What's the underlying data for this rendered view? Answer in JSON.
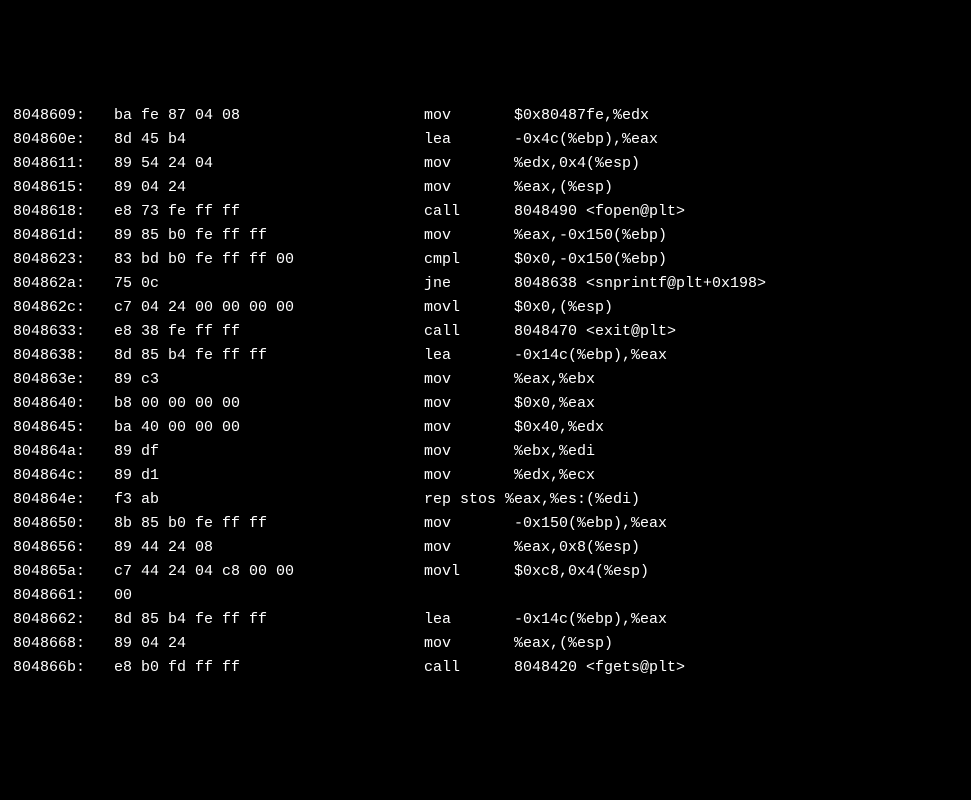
{
  "rows": [
    {
      "addr": " 8048609:",
      "bytes": "ba fe 87 04 08",
      "mnem": "mov",
      "ops": "$0x80487fe,%edx"
    },
    {
      "addr": " 804860e:",
      "bytes": "8d 45 b4",
      "mnem": "lea",
      "ops": "-0x4c(%ebp),%eax"
    },
    {
      "addr": " 8048611:",
      "bytes": "89 54 24 04",
      "mnem": "mov",
      "ops": "%edx,0x4(%esp)"
    },
    {
      "addr": " 8048615:",
      "bytes": "89 04 24",
      "mnem": "mov",
      "ops": "%eax,(%esp)"
    },
    {
      "addr": " 8048618:",
      "bytes": "e8 73 fe ff ff",
      "mnem": "call",
      "ops": "8048490 <fopen@plt>"
    },
    {
      "addr": " 804861d:",
      "bytes": "89 85 b0 fe ff ff",
      "mnem": "mov",
      "ops": "%eax,-0x150(%ebp)"
    },
    {
      "addr": " 8048623:",
      "bytes": "83 bd b0 fe ff ff 00",
      "mnem": "cmpl",
      "ops": "$0x0,-0x150(%ebp)"
    },
    {
      "addr": " 804862a:",
      "bytes": "75 0c",
      "mnem": "jne",
      "ops": "8048638 <snprintf@plt+0x198>"
    },
    {
      "addr": " 804862c:",
      "bytes": "c7 04 24 00 00 00 00",
      "mnem": "movl",
      "ops": "$0x0,(%esp)"
    },
    {
      "addr": " 8048633:",
      "bytes": "e8 38 fe ff ff",
      "mnem": "call",
      "ops": "8048470 <exit@plt>"
    },
    {
      "addr": " 8048638:",
      "bytes": "8d 85 b4 fe ff ff",
      "mnem": "lea",
      "ops": "-0x14c(%ebp),%eax"
    },
    {
      "addr": " 804863e:",
      "bytes": "89 c3",
      "mnem": "mov",
      "ops": "%eax,%ebx"
    },
    {
      "addr": " 8048640:",
      "bytes": "b8 00 00 00 00",
      "mnem": "mov",
      "ops": "$0x0,%eax"
    },
    {
      "addr": " 8048645:",
      "bytes": "ba 40 00 00 00",
      "mnem": "mov",
      "ops": "$0x40,%edx"
    },
    {
      "addr": " 804864a:",
      "bytes": "89 df",
      "mnem": "mov",
      "ops": "%ebx,%edi"
    },
    {
      "addr": " 804864c:",
      "bytes": "89 d1",
      "mnem": "mov",
      "ops": "%edx,%ecx"
    },
    {
      "addr": " 804864e:",
      "bytes": "f3 ab",
      "mnem": "rep stos %eax,%es:(%edi)",
      "ops": ""
    },
    {
      "addr": " 8048650:",
      "bytes": "8b 85 b0 fe ff ff",
      "mnem": "mov",
      "ops": "-0x150(%ebp),%eax"
    },
    {
      "addr": " 8048656:",
      "bytes": "89 44 24 08",
      "mnem": "mov",
      "ops": "%eax,0x8(%esp)"
    },
    {
      "addr": " 804865a:",
      "bytes": "c7 44 24 04 c8 00 00",
      "mnem": "movl",
      "ops": "$0xc8,0x4(%esp)"
    },
    {
      "addr": " 8048661:",
      "bytes": "00",
      "mnem": "",
      "ops": ""
    },
    {
      "addr": " 8048662:",
      "bytes": "8d 85 b4 fe ff ff",
      "mnem": "lea",
      "ops": "-0x14c(%ebp),%eax"
    },
    {
      "addr": " 8048668:",
      "bytes": "89 04 24",
      "mnem": "mov",
      "ops": "%eax,(%esp)"
    },
    {
      "addr": " 804866b:",
      "bytes": "e8 b0 fd ff ff",
      "mnem": "call",
      "ops": "8048420 <fgets@plt>"
    }
  ]
}
